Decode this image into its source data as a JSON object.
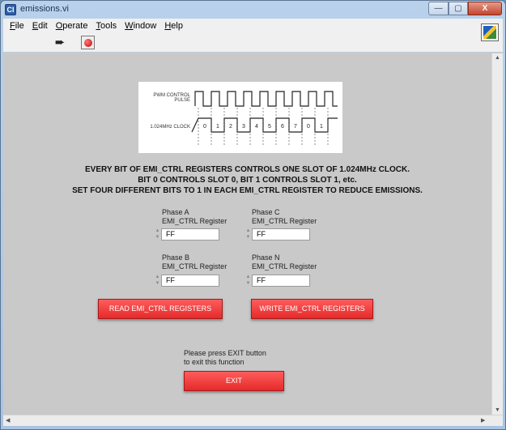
{
  "window": {
    "title": "emissions.vi",
    "close_label": "X",
    "app_icon_letter": "Cl"
  },
  "menu": [
    {
      "label": "File",
      "accel": "F",
      "rest": "ile"
    },
    {
      "label": "Edit",
      "accel": "E",
      "rest": "dit"
    },
    {
      "label": "Operate",
      "accel": "O",
      "rest": "perate"
    },
    {
      "label": "Tools",
      "accel": "T",
      "rest": "ools"
    },
    {
      "label": "Window",
      "accel": "W",
      "rest": "indow"
    },
    {
      "label": "Help",
      "accel": "H",
      "rest": "elp"
    }
  ],
  "toolbar": {
    "run_icon": "run-arrow-icon",
    "stop_icon": "abort-stop-icon"
  },
  "diagram": {
    "pwm_label": "PWM CONTROL PULSE",
    "clock_label": "1.024MHz CLOCK",
    "slots": [
      "0",
      "1",
      "2",
      "3",
      "4",
      "5",
      "6",
      "7",
      "0",
      "1"
    ]
  },
  "instructions": {
    "line1": "EVERY BIT OF EMI_CTRL REGISTERS CONTROLS ONE SLOT OF 1.024MHz CLOCK.",
    "line2": "BIT 0 CONTROLS SLOT 0, BIT 1 CONTROLS SLOT 1, etc.",
    "line3": "SET FOUR DIFFERENT BITS TO 1 IN EACH EMI_CTRL REGISTER TO REDUCE EMISSIONS."
  },
  "registers": {
    "a": {
      "phase": "Phase A",
      "label": "EMI_CTRL Register",
      "value": "FF"
    },
    "b": {
      "phase": "Phase B",
      "label": "EMI_CTRL Register",
      "value": "FF"
    },
    "c": {
      "phase": "Phase C",
      "label": "EMI_CTRL Register",
      "value": "FF"
    },
    "n": {
      "phase": "Phase N",
      "label": "EMI_CTRL Register",
      "value": "FF"
    }
  },
  "buttons": {
    "read": "READ EMI_CTRL REGISTERS",
    "write": "WRITE EMI_CTRL REGISTERS",
    "exit": "EXIT"
  },
  "exit_note": {
    "line1": "Please press EXIT button",
    "line2": "to exit this function"
  },
  "colors": {
    "panel": "#c9c9c9",
    "button_red": "#e52a2a"
  }
}
